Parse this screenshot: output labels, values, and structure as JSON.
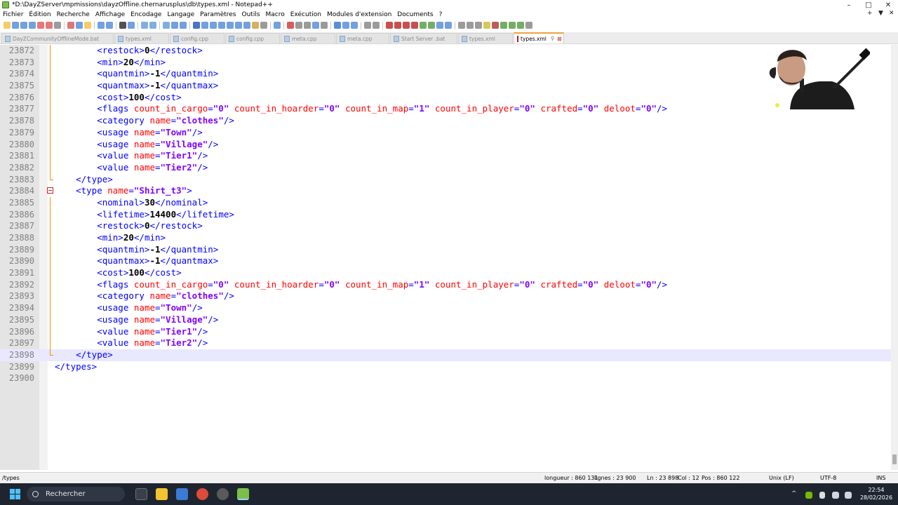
{
  "window": {
    "title": "*D:\\DayZServer\\mpmissions\\dayzOffline.chernarusplus\\db\\types.xml - Notepad++",
    "controls": {
      "minimize": "–",
      "maximize": "□",
      "close": "✕"
    }
  },
  "menu": {
    "items": [
      "Fichier",
      "Édition",
      "Recherche",
      "Affichage",
      "Encodage",
      "Langage",
      "Paramètres",
      "Outils",
      "Macro",
      "Exécution",
      "Modules d'extension",
      "Documents",
      "?"
    ],
    "right_controls": [
      "+",
      "▼",
      "✕"
    ]
  },
  "tabs": [
    {
      "label": "DayZCommunityOfflineMode.bat"
    },
    {
      "label": "types.xml"
    },
    {
      "label": "config.cpp"
    },
    {
      "label": "config.cpp"
    },
    {
      "label": "meta.cpp"
    },
    {
      "label": "meta.cpp"
    },
    {
      "label": "Start Server .bat"
    },
    {
      "label": "types.xml"
    },
    {
      "label": "types.xml",
      "active": true
    }
  ],
  "editor": {
    "lines": [
      {
        "n": "23872",
        "parts": [
          [
            "t",
            "        <restock>"
          ],
          [
            "x",
            "0"
          ],
          [
            "t",
            "</restock>"
          ]
        ]
      },
      {
        "n": "23873",
        "parts": [
          [
            "t",
            "        <min>"
          ],
          [
            "x",
            "20"
          ],
          [
            "t",
            "</min>"
          ]
        ]
      },
      {
        "n": "23874",
        "parts": [
          [
            "t",
            "        <quantmin>"
          ],
          [
            "x",
            "-1"
          ],
          [
            "t",
            "</quantmin>"
          ]
        ]
      },
      {
        "n": "23875",
        "parts": [
          [
            "t",
            "        <quantmax>"
          ],
          [
            "x",
            "-1"
          ],
          [
            "t",
            "</quantmax>"
          ]
        ]
      },
      {
        "n": "23876",
        "parts": [
          [
            "t",
            "        <cost>"
          ],
          [
            "x",
            "100"
          ],
          [
            "t",
            "</cost>"
          ]
        ]
      },
      {
        "n": "23877",
        "parts": [
          [
            "t",
            "        <flags "
          ],
          [
            "a",
            "count_in_cargo"
          ],
          [
            "t",
            "="
          ],
          [
            "v",
            "\"0\""
          ],
          [
            "t",
            " "
          ],
          [
            "a",
            "count_in_hoarder"
          ],
          [
            "t",
            "="
          ],
          [
            "v",
            "\"0\""
          ],
          [
            "t",
            " "
          ],
          [
            "a",
            "count_in_map"
          ],
          [
            "t",
            "="
          ],
          [
            "v",
            "\"1\""
          ],
          [
            "t",
            " "
          ],
          [
            "a",
            "count_in_player"
          ],
          [
            "t",
            "="
          ],
          [
            "v",
            "\"0\""
          ],
          [
            "t",
            " "
          ],
          [
            "a",
            "crafted"
          ],
          [
            "t",
            "="
          ],
          [
            "v",
            "\"0\""
          ],
          [
            "t",
            " "
          ],
          [
            "a",
            "deloot"
          ],
          [
            "t",
            "="
          ],
          [
            "v",
            "\"0\""
          ],
          [
            "t",
            "/>"
          ]
        ]
      },
      {
        "n": "23878",
        "parts": [
          [
            "t",
            "        <category "
          ],
          [
            "a",
            "name"
          ],
          [
            "t",
            "="
          ],
          [
            "v",
            "\"clothes\""
          ],
          [
            "t",
            "/>"
          ]
        ]
      },
      {
        "n": "23879",
        "parts": [
          [
            "t",
            "        <usage "
          ],
          [
            "a",
            "name"
          ],
          [
            "t",
            "="
          ],
          [
            "v",
            "\"Town\""
          ],
          [
            "t",
            "/>"
          ]
        ]
      },
      {
        "n": "23880",
        "parts": [
          [
            "t",
            "        <usage "
          ],
          [
            "a",
            "name"
          ],
          [
            "t",
            "="
          ],
          [
            "v",
            "\"Village\""
          ],
          [
            "t",
            "/>"
          ]
        ]
      },
      {
        "n": "23881",
        "parts": [
          [
            "t",
            "        <value "
          ],
          [
            "a",
            "name"
          ],
          [
            "t",
            "="
          ],
          [
            "v",
            "\"Tier1\""
          ],
          [
            "t",
            "/>"
          ]
        ]
      },
      {
        "n": "23882",
        "parts": [
          [
            "t",
            "        <value "
          ],
          [
            "a",
            "name"
          ],
          [
            "t",
            "="
          ],
          [
            "v",
            "\"Tier2\""
          ],
          [
            "t",
            "/>"
          ]
        ]
      },
      {
        "n": "23883",
        "parts": [
          [
            "t",
            "    </type>"
          ]
        ]
      },
      {
        "n": "23884",
        "parts": [
          [
            "t",
            "    <type "
          ],
          [
            "a",
            "name"
          ],
          [
            "t",
            "="
          ],
          [
            "v",
            "\"Shirt_t3\""
          ],
          [
            "t",
            ">"
          ]
        ]
      },
      {
        "n": "23885",
        "parts": [
          [
            "t",
            "        <nominal>"
          ],
          [
            "x",
            "30"
          ],
          [
            "t",
            "</nominal>"
          ]
        ]
      },
      {
        "n": "23886",
        "parts": [
          [
            "t",
            "        <lifetime>"
          ],
          [
            "x",
            "14400"
          ],
          [
            "t",
            "</lifetime>"
          ]
        ]
      },
      {
        "n": "23887",
        "parts": [
          [
            "t",
            "        <restock>"
          ],
          [
            "x",
            "0"
          ],
          [
            "t",
            "</restock>"
          ]
        ]
      },
      {
        "n": "23888",
        "parts": [
          [
            "t",
            "        <min>"
          ],
          [
            "x",
            "20"
          ],
          [
            "t",
            "</min>"
          ]
        ]
      },
      {
        "n": "23889",
        "parts": [
          [
            "t",
            "        <quantmin>"
          ],
          [
            "x",
            "-1"
          ],
          [
            "t",
            "</quantmin>"
          ]
        ]
      },
      {
        "n": "23890",
        "parts": [
          [
            "t",
            "        <quantmax>"
          ],
          [
            "x",
            "-1"
          ],
          [
            "t",
            "</quantmax>"
          ]
        ]
      },
      {
        "n": "23891",
        "parts": [
          [
            "t",
            "        <cost>"
          ],
          [
            "x",
            "100"
          ],
          [
            "t",
            "</cost>"
          ]
        ]
      },
      {
        "n": "23892",
        "parts": [
          [
            "t",
            "        <flags "
          ],
          [
            "a",
            "count_in_cargo"
          ],
          [
            "t",
            "="
          ],
          [
            "v",
            "\"0\""
          ],
          [
            "t",
            " "
          ],
          [
            "a",
            "count_in_hoarder"
          ],
          [
            "t",
            "="
          ],
          [
            "v",
            "\"0\""
          ],
          [
            "t",
            " "
          ],
          [
            "a",
            "count_in_map"
          ],
          [
            "t",
            "="
          ],
          [
            "v",
            "\"1\""
          ],
          [
            "t",
            " "
          ],
          [
            "a",
            "count_in_player"
          ],
          [
            "t",
            "="
          ],
          [
            "v",
            "\"0\""
          ],
          [
            "t",
            " "
          ],
          [
            "a",
            "crafted"
          ],
          [
            "t",
            "="
          ],
          [
            "v",
            "\"0\""
          ],
          [
            "t",
            " "
          ],
          [
            "a",
            "deloot"
          ],
          [
            "t",
            "="
          ],
          [
            "v",
            "\"0\""
          ],
          [
            "t",
            "/>"
          ]
        ]
      },
      {
        "n": "23893",
        "parts": [
          [
            "t",
            "        <category "
          ],
          [
            "a",
            "name"
          ],
          [
            "t",
            "="
          ],
          [
            "v",
            "\"clothes\""
          ],
          [
            "t",
            "/>"
          ]
        ]
      },
      {
        "n": "23894",
        "parts": [
          [
            "t",
            "        <usage "
          ],
          [
            "a",
            "name"
          ],
          [
            "t",
            "="
          ],
          [
            "v",
            "\"Town\""
          ],
          [
            "t",
            "/>"
          ]
        ]
      },
      {
        "n": "23895",
        "parts": [
          [
            "t",
            "        <usage "
          ],
          [
            "a",
            "name"
          ],
          [
            "t",
            "="
          ],
          [
            "v",
            "\"Village\""
          ],
          [
            "t",
            "/>"
          ]
        ]
      },
      {
        "n": "23896",
        "parts": [
          [
            "t",
            "        <value "
          ],
          [
            "a",
            "name"
          ],
          [
            "t",
            "="
          ],
          [
            "v",
            "\"Tier1\""
          ],
          [
            "t",
            "/>"
          ]
        ]
      },
      {
        "n": "23897",
        "parts": [
          [
            "t",
            "        <value "
          ],
          [
            "a",
            "name"
          ],
          [
            "t",
            "="
          ],
          [
            "v",
            "\"Tier2\""
          ],
          [
            "t",
            "/>"
          ]
        ]
      },
      {
        "n": "23898",
        "parts": [
          [
            "t",
            "    </type>"
          ]
        ],
        "current": true
      },
      {
        "n": "23899",
        "parts": [
          [
            "t",
            "</types>"
          ]
        ]
      },
      {
        "n": "23900",
        "parts": []
      }
    ]
  },
  "status": {
    "path": "/types",
    "length": "longueur : 860 131",
    "lines": "lignes : 23 900",
    "ln": "Ln : 23 898",
    "col": "Col : 12",
    "pos": "Pos : 860 122",
    "eol": "Unix (LF)",
    "encoding": "UTF-8",
    "mode": "INS"
  },
  "taskbar": {
    "search_placeholder": "Rechercher",
    "time": "22:54",
    "date": "28/02/2026"
  },
  "colors": {
    "tag": "#0000ff",
    "attribute": "#ff0000",
    "value": "#8000ff",
    "current_line": "#e8e8ff",
    "fold_marker": "#ff8a00"
  }
}
